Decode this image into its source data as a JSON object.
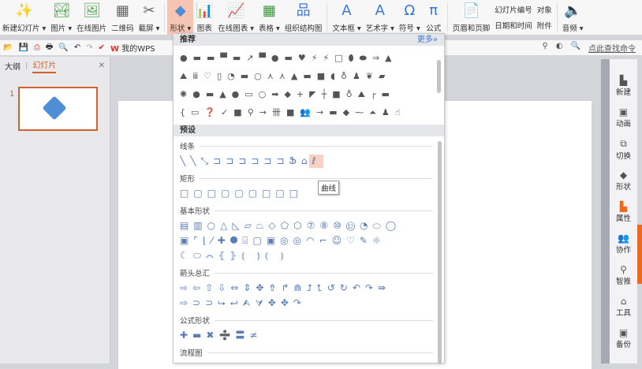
{
  "ribbon": [
    {
      "id": "new-slide",
      "icon": "✨",
      "label": "新建幻灯片 ▾"
    },
    {
      "id": "picture",
      "icon": "🏞",
      "label": "图片 ▾"
    },
    {
      "id": "online-picture",
      "icon": "🖼",
      "label": "在线图片"
    },
    {
      "id": "qrcode",
      "icon": "▦",
      "label": "二维码"
    },
    {
      "id": "screenshot",
      "icon": "✂",
      "label": "截屏 ▾"
    },
    {
      "id": "shapes",
      "icon": "◆",
      "label": "形状 ▾",
      "active": true
    },
    {
      "id": "chart",
      "icon": "📊",
      "label": "图表"
    },
    {
      "id": "online-chart",
      "icon": "📈",
      "label": "在线图表 ▾"
    },
    {
      "id": "table",
      "icon": "▦",
      "label": "表格 ▾"
    },
    {
      "id": "smartart",
      "icon": "品",
      "label": "组织结构图"
    },
    {
      "id": "textbox",
      "icon": "A",
      "label": "文本框 ▾"
    },
    {
      "id": "wordart",
      "icon": "A",
      "label": "艺术字 ▾"
    },
    {
      "id": "symbol",
      "icon": "Ω",
      "label": "符号 ▾"
    },
    {
      "id": "formula",
      "icon": "π",
      "label": "公式"
    },
    {
      "id": "header-footer",
      "icon": "📄",
      "label": "页眉和页脚"
    }
  ],
  "ribbon_small": [
    "幻灯片编号",
    "日期和时间",
    "对象",
    "附件"
  ],
  "audio": {
    "icon": "🔈",
    "label": "音频 ▾"
  },
  "quick": {
    "wps": "我的WPS",
    "search": "点此查找命令"
  },
  "left": {
    "tab_outline": "大纲",
    "tab_slides": "幻灯片",
    "slide_num": "1",
    "close": "✕"
  },
  "right": [
    {
      "g": "▙",
      "l": "新建"
    },
    {
      "g": "▣",
      "l": "动画"
    },
    {
      "g": "⧉",
      "l": "切换"
    },
    {
      "g": "◆",
      "l": "形状"
    },
    {
      "g": "▙",
      "l": "属性",
      "on": true
    },
    {
      "g": "👥",
      "l": "协作"
    },
    {
      "g": "⚲",
      "l": "智推"
    },
    {
      "g": "⌂",
      "l": "工具"
    },
    {
      "g": "▣",
      "l": "备份"
    }
  ],
  "dropdown": {
    "recommended": "推荐",
    "more": "更多»",
    "presets": "预设",
    "tooltip": "曲线",
    "rec_rows": [
      "●▬▬▀▬↗▀●▬♥⚡⚡□⬮⬬⇒▲",
      "⛰ⅲ♡▯◔▬○⋏⋏▲▬■◖♁♟❦▰",
      "✺●▬▲●▭○➡◆+◤┼■♁⛰┌▬",
      "{▭❓✓■⚲→卌■👥→▬◆⁓⏶♟☝"
    ],
    "sections": [
      {
        "title": "线条",
        "rows": [
          "╲╲⤡⊐⊐⊐⊐⊐⊐Ֆ⌂ℓ"
        ],
        "hl": 9
      },
      {
        "title": "矩形",
        "rows": [
          "□▢□▢▢▢□□□"
        ]
      },
      {
        "title": "基本形状",
        "rows": [
          "▤▥○△◺▱⏢◇⬠⬡⑦⑧⑩⑫◔⬭◯",
          "▣⌜⌊⁄✚⯃⌸▢▣◎◎◠⌐☺♡✎☼",
          "☾⬭⌒⦃⦄⦅ ⦆⦅ ⦆"
        ]
      },
      {
        "title": "箭头总汇",
        "rows": [
          "⇨⇦⇧⇩⇔⇕✥⇮↱⋒⮥⮤↺↻↶↷⇛",
          "⇨⊃⊃⮡⮠⮙⮛✥✥↷"
        ]
      },
      {
        "title": "公式形状",
        "rows": [
          "✚▬✖➗〓≠"
        ]
      },
      {
        "title": "流程图",
        "rows": []
      }
    ]
  }
}
